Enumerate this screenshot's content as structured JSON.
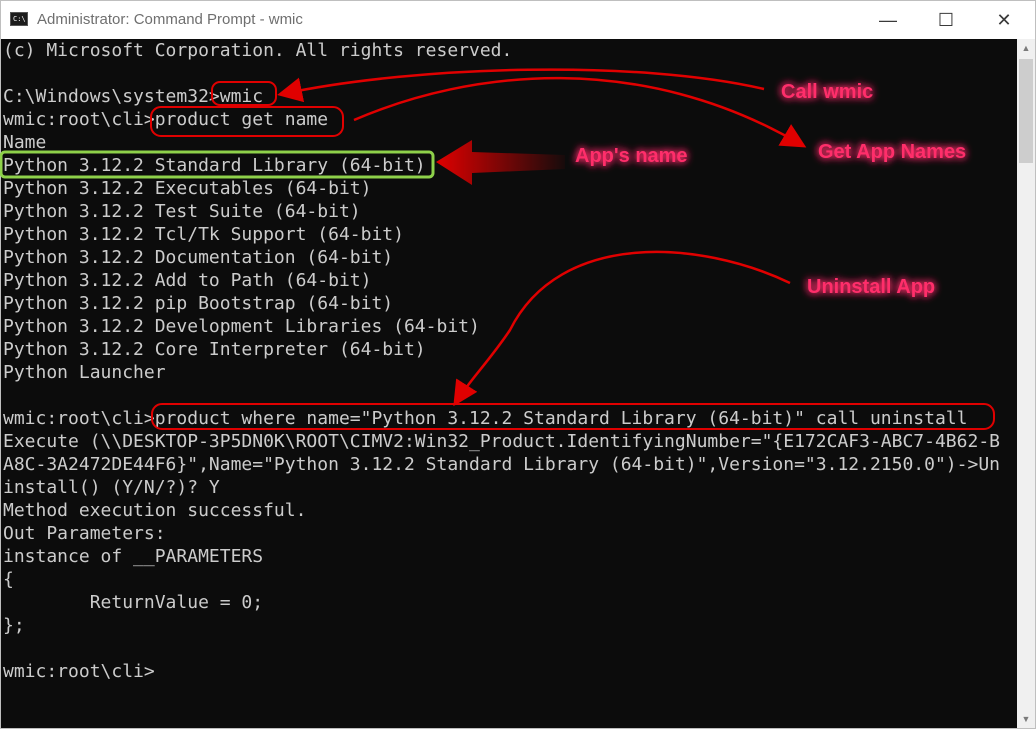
{
  "window": {
    "title": "Administrator: Command Prompt - wmic",
    "icon_text": "C:\\",
    "controls": {
      "minimize": "—",
      "maximize": "☐",
      "close": "✕"
    }
  },
  "terminal": {
    "lines": [
      "(c) Microsoft Corporation. All rights reserved.",
      "",
      "C:\\Windows\\system32>wmic",
      "wmic:root\\cli>product get name",
      "Name",
      "Python 3.12.2 Standard Library (64-bit)",
      "Python 3.12.2 Executables (64-bit)",
      "Python 3.12.2 Test Suite (64-bit)",
      "Python 3.12.2 Tcl/Tk Support (64-bit)",
      "Python 3.12.2 Documentation (64-bit)",
      "Python 3.12.2 Add to Path (64-bit)",
      "Python 3.12.2 pip Bootstrap (64-bit)",
      "Python 3.12.2 Development Libraries (64-bit)",
      "Python 3.12.2 Core Interpreter (64-bit)",
      "Python Launcher",
      "",
      "wmic:root\\cli>product where name=\"Python 3.12.2 Standard Library (64-bit)\" call uninstall",
      "Execute (\\\\DESKTOP-3P5DN0K\\ROOT\\CIMV2:Win32_Product.IdentifyingNumber=\"{E172CAF3-ABC7-4B62-B",
      "A8C-3A2472DE44F6}\",Name=\"Python 3.12.2 Standard Library (64-bit)\",Version=\"3.12.2150.0\")->Un",
      "install() (Y/N/?)? Y",
      "Method execution successful.",
      "Out Parameters:",
      "instance of __PARAMETERS",
      "{",
      "        ReturnValue = 0;",
      "};",
      "",
      "wmic:root\\cli>"
    ]
  },
  "annotations": {
    "call_wmic": "Call wmic",
    "get_app_names": "Get App Names",
    "apps_name": "App's name",
    "uninstall_app": "Uninstall App",
    "arrow_color": "#e00000",
    "highlight_color": "#8ed14a",
    "label_color": "#ff2d6b"
  }
}
